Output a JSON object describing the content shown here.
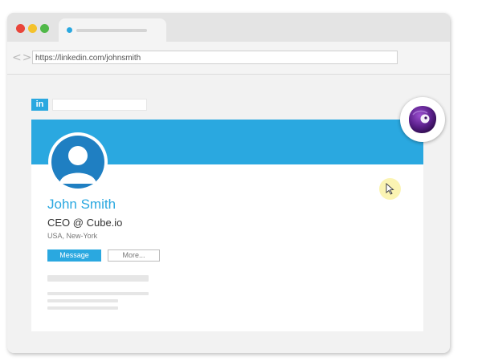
{
  "browser": {
    "url": "https://linkedin.com/johnsmith",
    "window_controls": [
      "close",
      "minimize",
      "maximize"
    ],
    "nav_icon": "code-arrows-icon"
  },
  "site": {
    "logo_text": "in",
    "brand_color": "#2aa8e0"
  },
  "profile": {
    "name": "John Smith",
    "headline": "CEO @ Cube.io",
    "location": "USA, New-York",
    "avatar_icon": "user-silhouette-icon"
  },
  "actions": {
    "message_label": "Message",
    "more_label": "More..."
  },
  "overlay": {
    "cursor_icon": "mouse-pointer-icon",
    "assistant_icon": "purple-orb-icon"
  }
}
